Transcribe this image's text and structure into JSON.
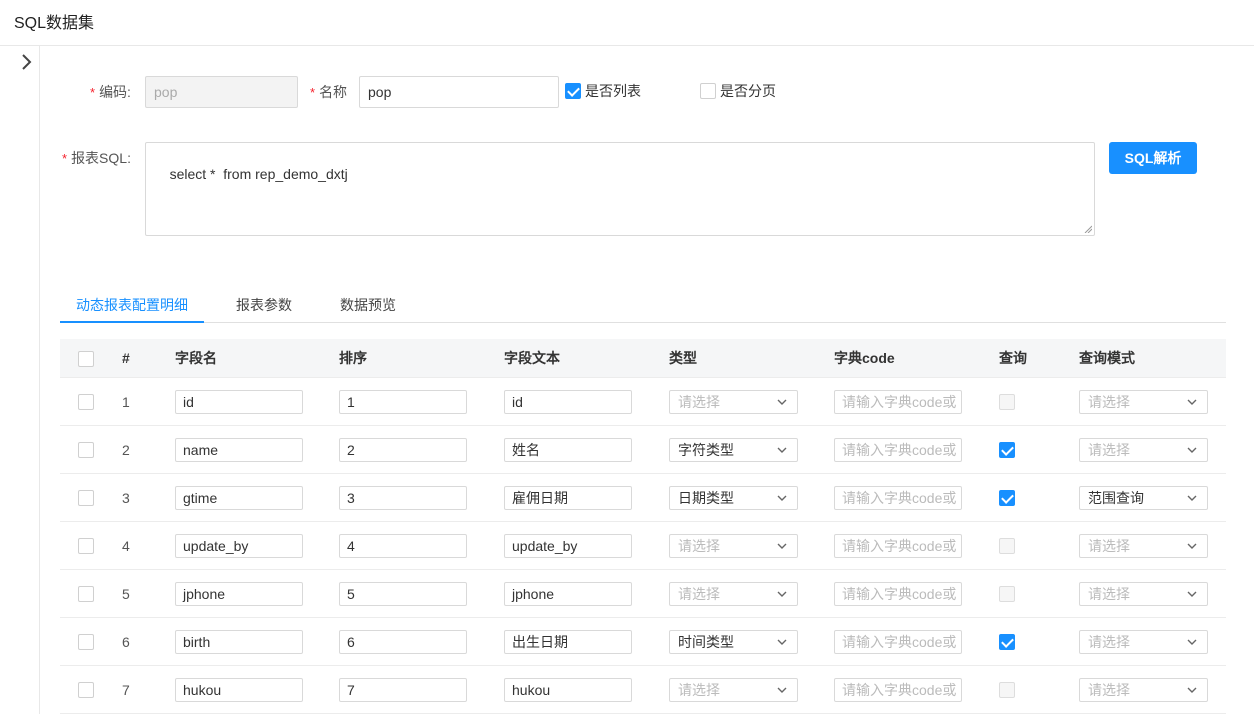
{
  "header": {
    "title": "SQL数据集"
  },
  "form": {
    "code_label": "编码:",
    "code_value": "pop",
    "name_label": "名称",
    "name_value": "pop",
    "is_list_label": "是否列表",
    "is_list_checked": true,
    "is_paged_label": "是否分页",
    "is_paged_checked": false,
    "sql_label": "报表SQL:",
    "sql_value": "select *  from rep_demo_dxtj",
    "parse_button": "SQL解析",
    "required_mark": "*"
  },
  "tabs": [
    {
      "label": "动态报表配置明细",
      "active": true
    },
    {
      "label": "报表参数",
      "active": false
    },
    {
      "label": "数据预览",
      "active": false
    }
  ],
  "table": {
    "headers": [
      "#",
      "字段名",
      "排序",
      "字段文本",
      "类型",
      "字典code",
      "查询",
      "查询模式"
    ],
    "dict_placeholder": "请输入字典code或",
    "select_placeholder": "请选择",
    "rows": [
      {
        "num": "1",
        "field": "id",
        "order": "1",
        "text": "id",
        "type": "",
        "query": false,
        "mode": ""
      },
      {
        "num": "2",
        "field": "name",
        "order": "2",
        "text": "姓名",
        "type": "字符类型",
        "query": true,
        "mode": ""
      },
      {
        "num": "3",
        "field": "gtime",
        "order": "3",
        "text": "雇佣日期",
        "type": "日期类型",
        "query": true,
        "mode": "范围查询"
      },
      {
        "num": "4",
        "field": "update_by",
        "order": "4",
        "text": "update_by",
        "type": "",
        "query": false,
        "mode": ""
      },
      {
        "num": "5",
        "field": "jphone",
        "order": "5",
        "text": "jphone",
        "type": "",
        "query": false,
        "mode": ""
      },
      {
        "num": "6",
        "field": "birth",
        "order": "6",
        "text": "出生日期",
        "type": "时间类型",
        "query": true,
        "mode": ""
      },
      {
        "num": "7",
        "field": "hukou",
        "order": "7",
        "text": "hukou",
        "type": "",
        "query": false,
        "mode": ""
      }
    ]
  },
  "colors": {
    "accent": "#1890ff",
    "required": "#f5222d"
  },
  "icons": {
    "sidebar_toggle": "chevron-right-icon",
    "dropdown": "chevron-down-icon"
  }
}
